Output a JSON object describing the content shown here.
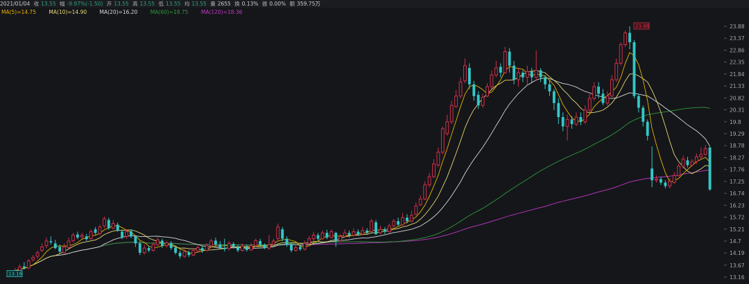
{
  "quote": {
    "date": "2021/01/04",
    "close_label": "收",
    "close": "13.55",
    "change_label": "幅",
    "change": "-9.97%(-1.50)",
    "open_label": "开",
    "open": "13.55",
    "high_label": "高",
    "high": "13.55",
    "low_label": "低",
    "low": "13.55",
    "avg_label": "均",
    "avg": "13.55",
    "volume_label": "量",
    "volume": "2655",
    "turnover_label": "换",
    "turnover": "0.13%",
    "amplitude_label": "振",
    "amplitude": "0.00%",
    "amount_label": "额",
    "amount": "359.75万"
  },
  "ma_legend": [
    {
      "text": "MA(5)=14.75",
      "color": "#e8b400"
    },
    {
      "text": "MA(10)=14.90",
      "color": "#e6d97a"
    },
    {
      "text": "MA(20)=16.20",
      "color": "#d9d9d9"
    },
    {
      "text": "MA(60)=18.75",
      "color": "#2e9a3a"
    },
    {
      "text": "MA(120)=18.36",
      "color": "#c238c8"
    }
  ],
  "chart_data": {
    "type": "candlestick",
    "y_ticks": [
      "23.88",
      "23.37",
      "22.86",
      "22.35",
      "21.84",
      "21.33",
      "20.82",
      "20.31",
      "19.8",
      "19.29",
      "18.78",
      "18.27",
      "17.76",
      "17.25",
      "16.74",
      "16.23",
      "15.72",
      "15.21",
      "14.7",
      "14.19",
      "13.67",
      "13.16"
    ],
    "ylim": [
      13.16,
      23.88
    ],
    "max_marker": "23.88",
    "min_marker": "13.16",
    "colors": {
      "up": "#d0314a",
      "down": "#33c8c8",
      "ma5": "#e8b400",
      "ma10": "#e6d97a",
      "ma20": "#d9d9d9",
      "ma60": "#2e9a3a",
      "ma120": "#c238c8"
    },
    "candles": [
      [
        13.4,
        13.42,
        13.35,
        13.55
      ],
      [
        13.45,
        13.6,
        13.42,
        13.7
      ],
      [
        13.62,
        13.55,
        13.48,
        13.8
      ],
      [
        13.55,
        13.85,
        13.5,
        13.92
      ],
      [
        13.9,
        14.0,
        13.82,
        14.1
      ],
      [
        14.05,
        14.2,
        13.95,
        14.3
      ],
      [
        14.3,
        14.45,
        14.22,
        14.6
      ],
      [
        14.5,
        14.7,
        14.4,
        14.85
      ],
      [
        14.7,
        14.65,
        14.55,
        14.9
      ],
      [
        14.6,
        14.4,
        14.35,
        14.75
      ],
      [
        14.45,
        14.25,
        14.18,
        14.55
      ],
      [
        14.2,
        14.45,
        14.15,
        14.6
      ],
      [
        14.42,
        14.7,
        14.38,
        14.85
      ],
      [
        14.72,
        14.95,
        14.65,
        15.05
      ],
      [
        14.98,
        14.85,
        14.78,
        15.1
      ],
      [
        14.88,
        14.95,
        14.8,
        15.05
      ],
      [
        14.9,
        14.78,
        14.7,
        15.0
      ],
      [
        14.8,
        15.1,
        14.75,
        15.2
      ],
      [
        15.2,
        15.05,
        14.98,
        15.3
      ],
      [
        15.02,
        15.3,
        14.95,
        15.4
      ],
      [
        15.35,
        15.65,
        15.25,
        15.75
      ],
      [
        15.6,
        15.25,
        15.18,
        15.7
      ],
      [
        15.25,
        15.45,
        15.2,
        15.6
      ],
      [
        15.4,
        15.15,
        15.1,
        15.5
      ],
      [
        15.1,
        14.85,
        14.78,
        15.2
      ],
      [
        14.9,
        15.1,
        14.8,
        15.2
      ],
      [
        15.12,
        14.9,
        14.82,
        15.2
      ],
      [
        14.9,
        14.6,
        14.45,
        14.95
      ],
      [
        14.6,
        14.2,
        14.1,
        14.7
      ],
      [
        14.2,
        14.4,
        14.12,
        14.55
      ],
      [
        14.4,
        14.3,
        14.22,
        14.5
      ],
      [
        14.3,
        14.55,
        14.25,
        14.65
      ],
      [
        14.55,
        14.75,
        14.48,
        14.85
      ],
      [
        14.72,
        14.5,
        14.4,
        14.8
      ],
      [
        14.5,
        14.62,
        14.42,
        14.72
      ],
      [
        14.6,
        14.4,
        14.32,
        14.7
      ],
      [
        14.42,
        14.2,
        14.12,
        14.5
      ],
      [
        14.2,
        14.05,
        13.95,
        14.3
      ],
      [
        14.05,
        14.25,
        13.98,
        14.35
      ],
      [
        14.22,
        14.1,
        14.02,
        14.3
      ],
      [
        14.1,
        14.3,
        14.05,
        14.4
      ],
      [
        14.28,
        14.42,
        14.22,
        14.55
      ],
      [
        14.4,
        14.28,
        14.2,
        14.5
      ],
      [
        14.3,
        14.5,
        14.25,
        14.6
      ],
      [
        14.5,
        14.7,
        14.42,
        14.8
      ],
      [
        14.72,
        14.55,
        14.45,
        14.85
      ],
      [
        14.55,
        14.4,
        14.35,
        14.7
      ],
      [
        14.4,
        14.35,
        14.25,
        14.8
      ],
      [
        14.38,
        14.6,
        14.3,
        14.7
      ],
      [
        14.58,
        14.45,
        14.38,
        14.65
      ],
      [
        14.45,
        14.3,
        14.22,
        14.55
      ],
      [
        14.3,
        14.48,
        14.25,
        14.6
      ],
      [
        14.45,
        14.32,
        14.25,
        14.55
      ],
      [
        14.32,
        14.5,
        14.28,
        14.62
      ],
      [
        14.5,
        14.72,
        14.45,
        14.8
      ],
      [
        14.7,
        14.55,
        14.48,
        14.8
      ],
      [
        14.55,
        14.4,
        14.35,
        14.6
      ],
      [
        14.4,
        14.55,
        14.32,
        14.95
      ],
      [
        14.55,
        14.7,
        14.5,
        14.8
      ],
      [
        14.8,
        15.3,
        14.72,
        15.45
      ],
      [
        15.2,
        14.8,
        14.7,
        15.3
      ],
      [
        14.8,
        14.55,
        14.45,
        14.9
      ],
      [
        14.55,
        14.3,
        14.22,
        14.65
      ],
      [
        14.3,
        14.42,
        14.25,
        14.55
      ],
      [
        14.45,
        14.35,
        14.28,
        14.55
      ],
      [
        14.35,
        14.6,
        14.3,
        14.72
      ],
      [
        14.6,
        14.8,
        14.55,
        14.92
      ],
      [
        14.8,
        14.95,
        14.7,
        15.1
      ],
      [
        14.95,
        14.8,
        14.72,
        15.05
      ],
      [
        14.8,
        15.05,
        14.75,
        15.15
      ],
      [
        15.05,
        14.85,
        14.78,
        15.18
      ],
      [
        14.85,
        15.1,
        14.8,
        15.2
      ],
      [
        15.05,
        14.7,
        14.45,
        15.1
      ],
      [
        14.72,
        14.9,
        14.65,
        15.0
      ],
      [
        14.9,
        15.05,
        14.85,
        15.2
      ],
      [
        15.05,
        14.95,
        14.85,
        15.15
      ],
      [
        14.95,
        15.1,
        14.9,
        15.25
      ],
      [
        15.1,
        15.0,
        14.92,
        15.2
      ],
      [
        15.0,
        15.15,
        14.95,
        15.3
      ],
      [
        15.15,
        15.05,
        14.98,
        15.25
      ],
      [
        15.1,
        15.55,
        15.0,
        15.65
      ],
      [
        15.5,
        15.0,
        14.95,
        15.6
      ],
      [
        15.05,
        15.2,
        15.0,
        15.35
      ],
      [
        15.2,
        15.1,
        15.0,
        15.3
      ],
      [
        15.1,
        15.35,
        15.05,
        15.45
      ],
      [
        15.35,
        15.55,
        15.3,
        15.65
      ],
      [
        15.55,
        15.4,
        15.35,
        15.7
      ],
      [
        15.4,
        15.7,
        15.35,
        15.9
      ],
      [
        15.7,
        15.55,
        15.45,
        15.85
      ],
      [
        15.55,
        15.8,
        15.5,
        16.0
      ],
      [
        15.85,
        16.2,
        15.8,
        16.35
      ],
      [
        16.25,
        16.5,
        16.2,
        16.65
      ],
      [
        16.5,
        17.1,
        16.45,
        17.25
      ],
      [
        17.1,
        17.45,
        17.0,
        17.6
      ],
      [
        17.45,
        18.0,
        17.4,
        18.2
      ],
      [
        17.95,
        18.5,
        17.85,
        18.7
      ],
      [
        18.5,
        19.5,
        18.4,
        19.6
      ],
      [
        19.3,
        19.8,
        19.2,
        20.1
      ],
      [
        19.8,
        20.5,
        19.7,
        20.7
      ],
      [
        20.45,
        20.9,
        20.4,
        21.15
      ],
      [
        20.9,
        21.5,
        20.8,
        21.7
      ],
      [
        21.55,
        22.2,
        21.45,
        22.5
      ],
      [
        22.1,
        21.4,
        21.2,
        22.3
      ],
      [
        21.4,
        20.9,
        20.7,
        21.55
      ],
      [
        20.95,
        20.5,
        20.35,
        21.1
      ],
      [
        20.5,
        20.85,
        20.4,
        21.0
      ],
      [
        20.9,
        21.3,
        20.85,
        21.45
      ],
      [
        21.3,
        21.8,
        21.2,
        22.0
      ],
      [
        21.8,
        22.1,
        21.7,
        22.4
      ],
      [
        22.15,
        21.9,
        21.7,
        22.3
      ],
      [
        21.9,
        22.8,
        21.85,
        23.0
      ],
      [
        22.8,
        22.2,
        21.9,
        22.95
      ],
      [
        22.2,
        21.6,
        21.4,
        22.4
      ],
      [
        21.6,
        21.9,
        21.3,
        22.1
      ],
      [
        21.9,
        21.7,
        21.5,
        22.0
      ],
      [
        21.7,
        21.95,
        21.4,
        22.2
      ],
      [
        21.95,
        21.7,
        21.5,
        22.1
      ],
      [
        21.7,
        22.0,
        21.55,
        22.85
      ],
      [
        22.0,
        21.7,
        21.5,
        22.1
      ],
      [
        21.7,
        21.4,
        21.2,
        21.8
      ],
      [
        21.4,
        21.1,
        20.9,
        21.6
      ],
      [
        21.1,
        20.6,
        20.3,
        21.2
      ],
      [
        20.6,
        20.0,
        19.7,
        20.8
      ],
      [
        20.0,
        19.6,
        19.4,
        20.2
      ],
      [
        19.6,
        19.9,
        19.0,
        20.1
      ],
      [
        19.9,
        19.7,
        19.5,
        20.05
      ],
      [
        19.7,
        20.0,
        19.6,
        20.2
      ],
      [
        20.0,
        19.8,
        19.65,
        20.2
      ],
      [
        19.8,
        20.3,
        19.7,
        20.5
      ],
      [
        20.3,
        20.8,
        20.2,
        21.0
      ],
      [
        20.8,
        21.3,
        20.7,
        21.5
      ],
      [
        21.3,
        21.0,
        20.8,
        21.5
      ],
      [
        21.0,
        20.6,
        20.5,
        21.2
      ],
      [
        20.6,
        20.9,
        20.5,
        21.1
      ],
      [
        20.9,
        21.6,
        20.85,
        21.8
      ],
      [
        21.6,
        22.3,
        21.5,
        22.5
      ],
      [
        22.3,
        23.1,
        22.2,
        23.2
      ],
      [
        23.1,
        23.6,
        23.0,
        23.7
      ],
      [
        23.6,
        23.2,
        22.9,
        23.88
      ],
      [
        23.2,
        20.9,
        20.8,
        23.3
      ],
      [
        20.9,
        20.4,
        20.2,
        21.0
      ],
      [
        20.4,
        19.8,
        19.6,
        20.5
      ],
      [
        19.8,
        19.2,
        19.0,
        19.9
      ],
      [
        17.8,
        17.3,
        17.0,
        18.75
      ],
      [
        17.3,
        17.35,
        17.2,
        17.5
      ],
      [
        17.35,
        17.2,
        17.1,
        17.45
      ],
      [
        17.2,
        17.05,
        16.95,
        17.3
      ],
      [
        17.05,
        17.25,
        16.95,
        17.4
      ],
      [
        17.2,
        17.5,
        17.15,
        17.65
      ],
      [
        17.5,
        17.9,
        17.45,
        18.0
      ],
      [
        17.9,
        18.2,
        17.8,
        18.35
      ],
      [
        18.15,
        17.95,
        17.85,
        18.3
      ],
      [
        17.95,
        18.1,
        17.9,
        18.2
      ],
      [
        18.1,
        18.3,
        18.0,
        18.45
      ],
      [
        18.3,
        18.4,
        18.2,
        18.7
      ],
      [
        18.4,
        18.65,
        18.35,
        18.8
      ],
      [
        18.7,
        16.9,
        16.85,
        18.75
      ]
    ]
  }
}
